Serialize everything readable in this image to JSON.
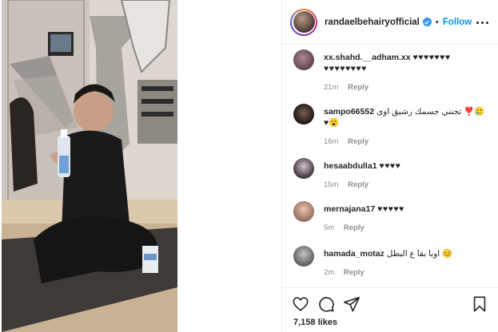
{
  "post": {
    "username": "randaelbehairyofficial",
    "follow_label": "Follow",
    "separator": "•",
    "likes": "7,158 likes"
  },
  "comments": [
    {
      "user": "xx.shahd.__adham.xx",
      "text": "♥♥♥♥♥♥♥",
      "text2": "♥♥♥♥♥♥♥♥",
      "time": "21m",
      "reply": "Reply",
      "avatar_color": "#7a5a62"
    },
    {
      "user": "sampo66552",
      "text": "تجنني جسمك رشيق اوى ❣️🥲",
      "text2": "♥😮",
      "time": "16m",
      "reply": "Reply",
      "avatar_color": "#3a2a25"
    },
    {
      "user": "hesaabdulla1",
      "text": "♥♥♥♥",
      "time": "15m",
      "reply": "Reply",
      "avatar_color": "#5d4e58"
    },
    {
      "user": "mernajana17",
      "text": "♥♥♥♥♥",
      "time": "5m",
      "reply": "Reply",
      "avatar_color": "#c9a08a"
    },
    {
      "user": "hamada_motaz",
      "text": "اوبا بقا ع البطل 😊",
      "time": "2m",
      "reply": "Reply",
      "avatar_color": "#8a8f95"
    }
  ],
  "icons": {
    "like": "heart-icon",
    "comment": "comment-icon",
    "share": "share-icon",
    "save": "bookmark-icon"
  },
  "colors": {
    "accent": "#0095f6",
    "muted": "#8e8e8e",
    "text": "#262626"
  }
}
